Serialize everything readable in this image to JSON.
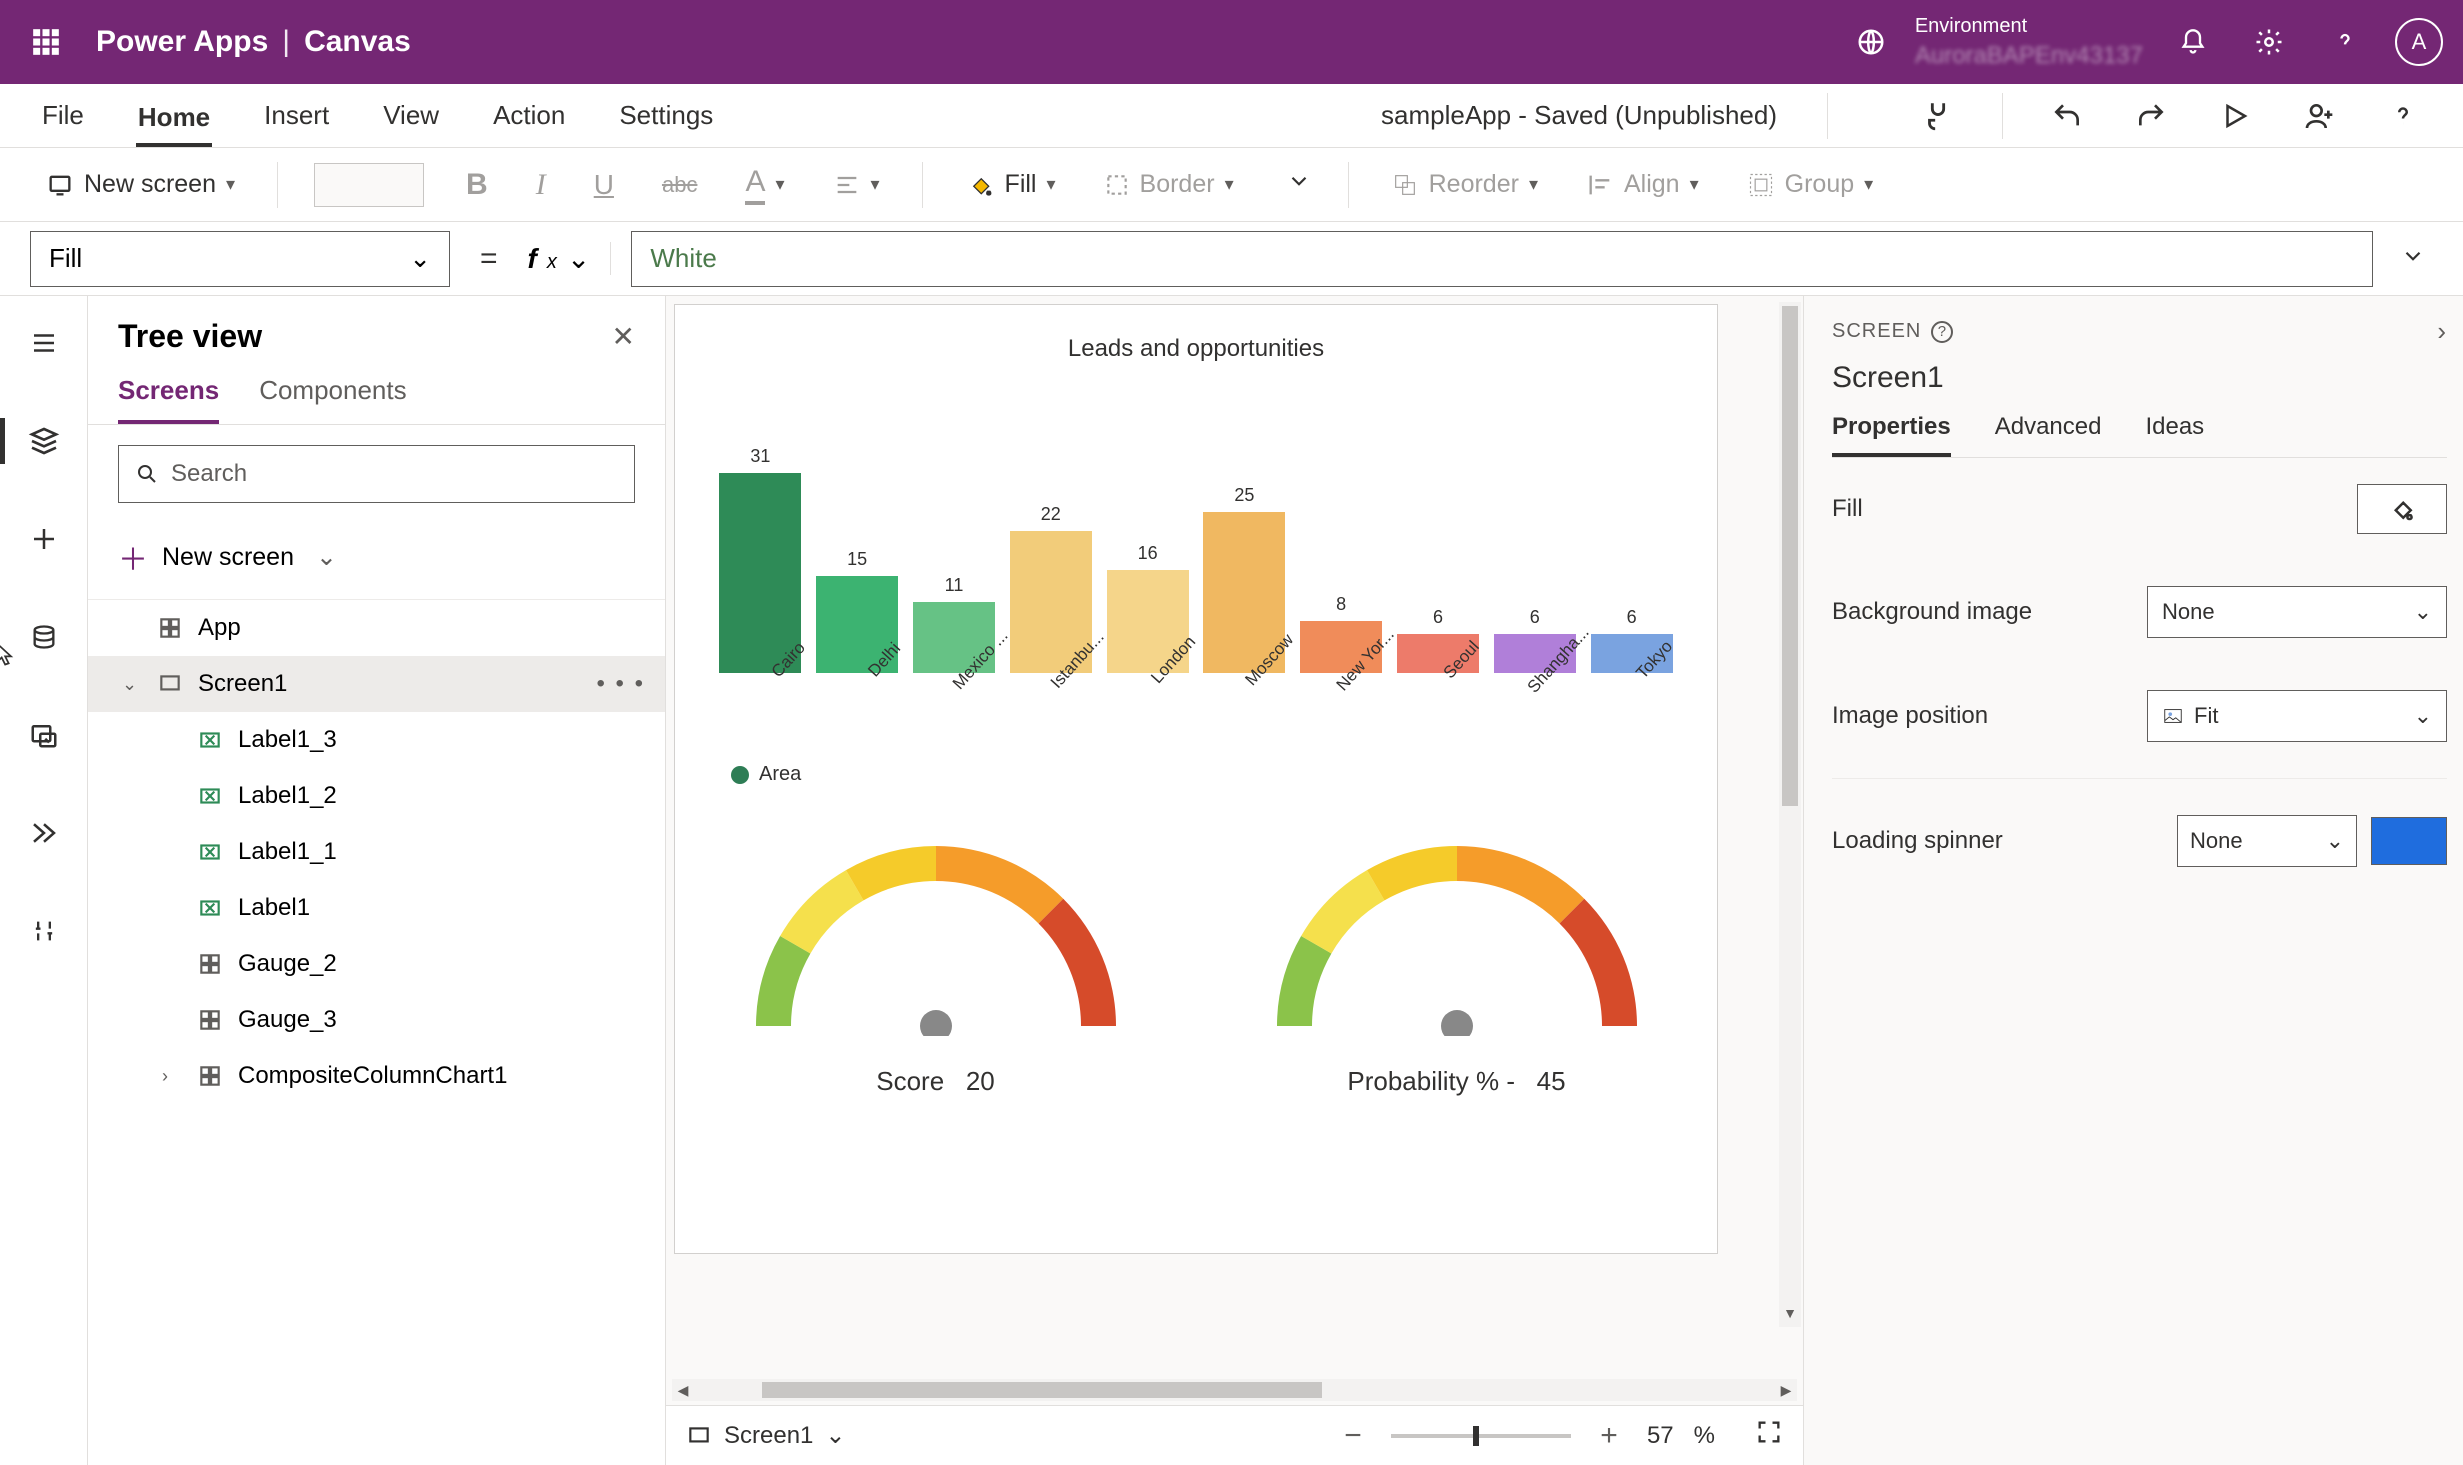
{
  "header": {
    "app_name": "Power Apps",
    "separator": "|",
    "app_mode": "Canvas",
    "env_label": "Environment",
    "env_name": "AuroraBAPEnv43137",
    "avatar_initial": "A"
  },
  "menu": {
    "items": [
      "File",
      "Home",
      "Insert",
      "View",
      "Action",
      "Settings"
    ],
    "active_index": 1,
    "doc_status": "sampleApp - Saved (Unpublished)"
  },
  "toolbar": {
    "new_screen": "New screen",
    "fill": "Fill",
    "border": "Border",
    "reorder": "Reorder",
    "align": "Align",
    "group": "Group"
  },
  "formula": {
    "property": "Fill",
    "value": "White"
  },
  "tree": {
    "title": "Tree view",
    "tabs": [
      "Screens",
      "Components"
    ],
    "active_tab": 0,
    "search_placeholder": "Search",
    "new_screen": "New screen",
    "items": [
      {
        "name": "App",
        "icon": "app",
        "depth": 0
      },
      {
        "name": "Screen1",
        "icon": "screen",
        "depth": 0,
        "selected": true,
        "expandable": true,
        "expanded": true,
        "more": true
      },
      {
        "name": "Label1_3",
        "icon": "label",
        "depth": 1
      },
      {
        "name": "Label1_2",
        "icon": "label",
        "depth": 1
      },
      {
        "name": "Label1_1",
        "icon": "label",
        "depth": 1
      },
      {
        "name": "Label1",
        "icon": "label",
        "depth": 1
      },
      {
        "name": "Gauge_2",
        "icon": "component",
        "depth": 1
      },
      {
        "name": "Gauge_3",
        "icon": "component",
        "depth": 1
      },
      {
        "name": "CompositeColumnChart1",
        "icon": "component",
        "depth": 1,
        "expandable": true,
        "expanded": false
      }
    ]
  },
  "chart_data": {
    "type": "bar",
    "title": "Leads and opportunities",
    "legend": "Area",
    "categories": [
      "Cairo",
      "Delhi",
      "Mexico ...",
      "Istanbu...",
      "London",
      "Moscow",
      "New Yor...",
      "Seoul",
      "Shangha...",
      "Tokyo"
    ],
    "values": [
      31,
      15,
      11,
      22,
      16,
      25,
      8,
      6,
      6,
      6
    ],
    "colors": [
      "#2e8b57",
      "#3cb371",
      "#66c285",
      "#f2cc7a",
      "#f5d58a",
      "#f0b861",
      "#f08c5a",
      "#ed7b6a",
      "#b07fd9",
      "#7aa3e0"
    ]
  },
  "gauges": [
    {
      "label": "Score",
      "value": 20,
      "needle_angle": -115
    },
    {
      "label": "Probability % -",
      "value": 45,
      "needle_angle": -62
    }
  ],
  "canvas_footer": {
    "screen": "Screen1",
    "zoom_pct": 57,
    "zoom_unit": "%"
  },
  "props": {
    "crumb": "SCREEN",
    "name": "Screen1",
    "tabs": [
      "Properties",
      "Advanced",
      "Ideas"
    ],
    "active_tab": 0,
    "rows": {
      "fill_label": "Fill",
      "bg_image_label": "Background image",
      "bg_image_value": "None",
      "img_pos_label": "Image position",
      "img_pos_value": "Fit",
      "spinner_label": "Loading spinner",
      "spinner_value": "None",
      "spinner_color": "#1f6dde"
    }
  }
}
